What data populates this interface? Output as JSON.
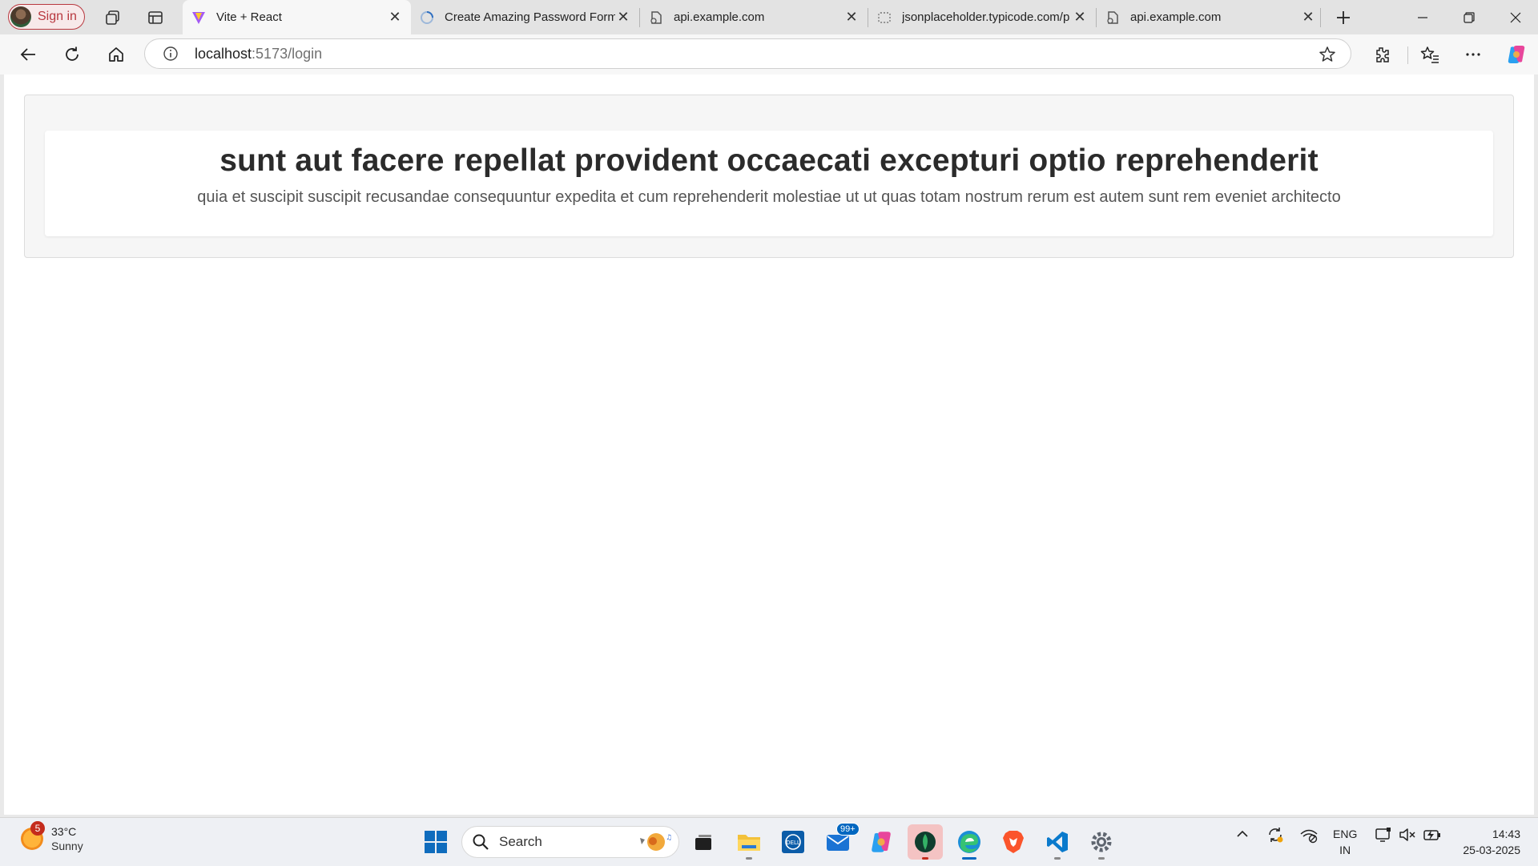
{
  "browser": {
    "profile_label": "Sign in",
    "tabs": [
      {
        "title": "Vite + React",
        "icon": "vite-icon",
        "active": true
      },
      {
        "title": "Create Amazing Password Form",
        "icon": "loading-icon",
        "active": false
      },
      {
        "title": "api.example.com",
        "icon": "error-page-icon",
        "active": false
      },
      {
        "title": "jsonplaceholder.typicode.com/p",
        "icon": "site-icon",
        "active": false
      },
      {
        "title": "api.example.com",
        "icon": "error-page-icon",
        "active": false
      }
    ],
    "address": {
      "host": "localhost",
      "path": ":5173/login"
    }
  },
  "page": {
    "post": {
      "title": "sunt aut facere repellat provident occaecati excepturi optio reprehenderit",
      "body": "quia et suscipit suscipit recusandae consequuntur expedita et cum reprehenderit molestiae ut ut quas totam nostrum rerum est autem sunt rem eveniet architecto"
    }
  },
  "taskbar": {
    "weather": {
      "badge": "5",
      "temp": "33°C",
      "condition": "Sunny"
    },
    "search_label": "Search",
    "mail_badge": "99+",
    "language": {
      "line1": "ENG",
      "line2": "IN"
    },
    "clock": {
      "time": "14:43",
      "date": "25-03-2025"
    }
  },
  "colors": {
    "accent": "#0067c0",
    "profile_red": "#b8383f",
    "page_background": "#ffffff"
  }
}
